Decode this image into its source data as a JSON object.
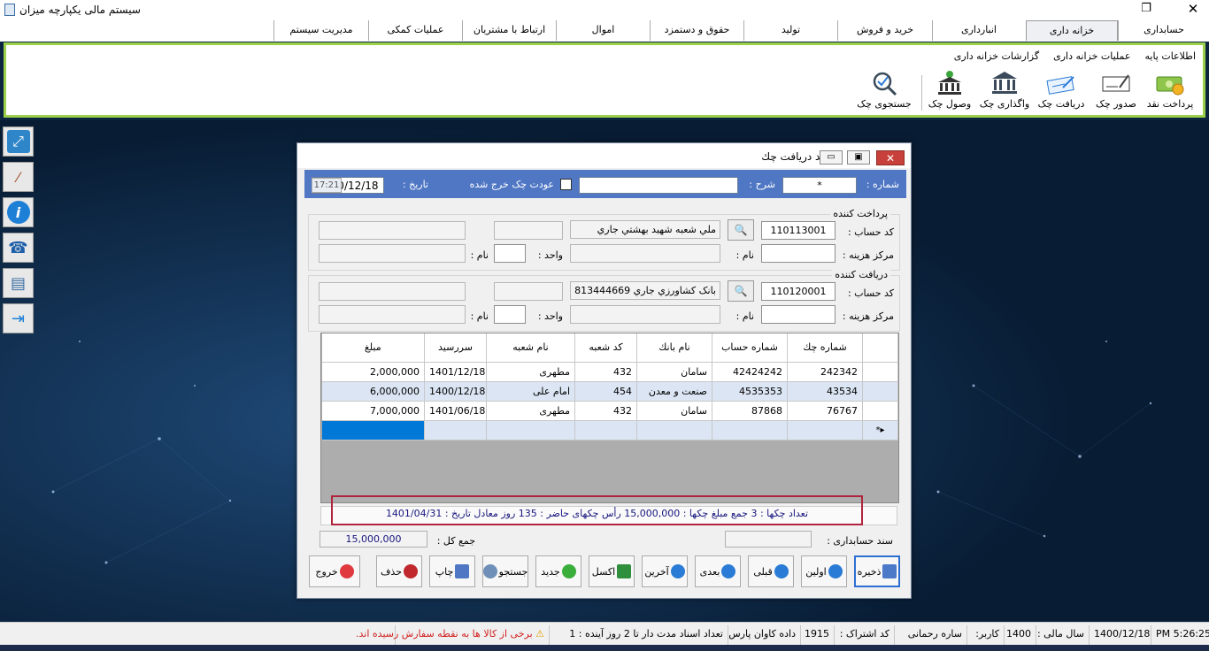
{
  "window": {
    "title": "سیستم مالی یکپارچه میزان"
  },
  "menu": {
    "tabs": [
      {
        "label": "حسابداری"
      },
      {
        "label": "خزانه داری",
        "active": true
      },
      {
        "label": "انبارداری"
      },
      {
        "label": "خرید و فروش"
      },
      {
        "label": "تولید"
      },
      {
        "label": "حقوق و دستمزد"
      },
      {
        "label": "اموال"
      },
      {
        "label": "ارتباط با مشتریان"
      },
      {
        "label": "عملیات کمکی"
      },
      {
        "label": "مدیریت سیستم"
      }
    ]
  },
  "ribbon": {
    "subtabs": [
      "اطلاعات پایه",
      "عملیات خزانه داری",
      "گزارشات خزانه داری"
    ],
    "buttons": [
      {
        "label": "پرداخت نقد",
        "icon": "cash-icon"
      },
      {
        "label": "صدور چک",
        "icon": "issue-check-icon"
      },
      {
        "label": "دریافت چک",
        "icon": "receive-check-icon"
      },
      {
        "label": "واگذاری چک",
        "icon": "bank-icon"
      },
      {
        "label": "وصول چک",
        "icon": "bank-collect-icon"
      },
      {
        "label": "جستجوی چک",
        "icon": "search-check-icon"
      }
    ]
  },
  "left_toolbar": [
    {
      "icon": "resize-icon"
    },
    {
      "icon": "wand-icon"
    },
    {
      "icon": "info-icon"
    },
    {
      "icon": "phone-icon"
    },
    {
      "icon": "notes-icon"
    },
    {
      "icon": "exit-icon"
    }
  ],
  "dialog": {
    "title": "سند دریافت چك",
    "header": {
      "number_label": "شماره :",
      "number_value": "*",
      "desc_label": "شرح :",
      "desc_value": "",
      "return_label": "عودت چک خرج شده",
      "date_label": "تاریخ :",
      "date_value": "1400/12/18",
      "time_value": "17:21"
    },
    "payer": {
      "title": "پرداخت كننده",
      "account_label": "کد حساب :",
      "account_code": "110113001",
      "account_name": "ملي شعبه شهيد بهشتي  جاري",
      "cost_center_label": "مرکز هزینه :",
      "name_label": "نام :",
      "unit_label": "واحد :",
      "name2_label": "نام :"
    },
    "receiver": {
      "title": "دریافت کننده",
      "account_label": "کد حساب :",
      "account_code": "110120001",
      "account_name": "بانک کشاورزي جاري 813444669",
      "cost_center_label": "مرکز هزینه :",
      "name_label": "نام :",
      "unit_label": "واحد :",
      "name2_label": "نام :"
    },
    "grid": {
      "columns": [
        "شماره چك",
        "شماره حساب",
        "نام بانك",
        "كد شعبه",
        "نام شعبه",
        "سررسيد",
        "مبلغ"
      ],
      "rows": [
        [
          "242342",
          "42424242",
          "سامان",
          "432",
          "مطهری",
          "1401/12/18",
          "2,000,000"
        ],
        [
          "43534",
          "4535353",
          "صنعت و معدن",
          "454",
          "امام علی",
          "1400/12/18",
          "6,000,000"
        ],
        [
          "76767",
          "87868",
          "سامان",
          "432",
          "مطهری",
          "1401/06/18",
          "7,000,000"
        ]
      ],
      "new_row_marker": "*"
    },
    "summary": "تعداد چکها : 3 جمع مبلغ چکها :  15,000,000  رأس چکهای حاضر : 135 روز معادل تاریخ : 1401/04/31",
    "accounting_doc_label": "سند حسابداری :",
    "total_label": "جمع کل :",
    "total_value": "15,000,000",
    "buttons": [
      {
        "label": "ذخیره",
        "icon": "save-icon"
      },
      {
        "label": "اولین",
        "icon": "first-icon"
      },
      {
        "label": "قبلی",
        "icon": "prev-icon"
      },
      {
        "label": "بعدی",
        "icon": "next-icon"
      },
      {
        "label": "آخرین",
        "icon": "last-icon"
      },
      {
        "label": "اكسل",
        "icon": "excel-icon"
      },
      {
        "label": "جدید",
        "icon": "add-icon"
      },
      {
        "label": "جستجو",
        "icon": "search-icon"
      },
      {
        "label": "چاپ",
        "icon": "print-icon"
      },
      {
        "label": "حذف",
        "icon": "delete-icon"
      },
      {
        "label": "خروج",
        "icon": "exit-icon"
      }
    ]
  },
  "statusbar": {
    "time": "PM 5:26:25",
    "date": "1400/12/18",
    "fiscal_year_label": "سال مالی :",
    "fiscal_year": "1400",
    "user_label": "کاربر:",
    "user": "ساره رحمانی",
    "subscription_label": "کد اشتراک :",
    "subscription": "1915",
    "company": "داده کاوان پارس",
    "docs": "تعداد اسناد مدت دار تا 2 روز آینده : 1",
    "alert": "برخی از کالا ها به نقطه سفارش رسیده اند."
  },
  "colors": {
    "ribbon_border": "#9bd04a",
    "dialog_header": "#4f77c4",
    "summary_border": "#b0253e",
    "summary_text": "#16157e",
    "selection": "#0078d7",
    "alert": "#d12020"
  }
}
